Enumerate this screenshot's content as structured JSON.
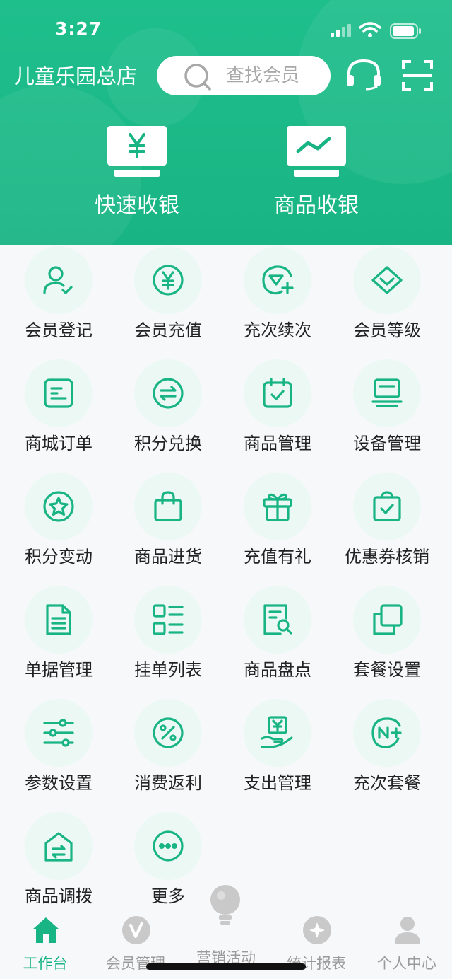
{
  "status_bar": {
    "time": "3:27"
  },
  "header": {
    "store_name": "儿童乐园总店",
    "search_placeholder": "查找会员",
    "quick_actions": [
      {
        "label": "快速收银",
        "icon": "yen-monitor-icon"
      },
      {
        "label": "商品收银",
        "icon": "chart-monitor-icon"
      }
    ]
  },
  "grid_items": [
    {
      "label": "会员登记",
      "icon": "user-check-icon"
    },
    {
      "label": "会员充值",
      "icon": "yen-circle-icon"
    },
    {
      "label": "充次续次",
      "icon": "diamond-plus-icon"
    },
    {
      "label": "会员等级",
      "icon": "diamond-icon"
    },
    {
      "label": "商城订单",
      "icon": "order-doc-icon"
    },
    {
      "label": "积分兑换",
      "icon": "exchange-icon"
    },
    {
      "label": "商品管理",
      "icon": "calendar-check-icon"
    },
    {
      "label": "设备管理",
      "icon": "device-icon"
    },
    {
      "label": "积分变动",
      "icon": "star-circle-icon"
    },
    {
      "label": "商品进货",
      "icon": "shopping-bag-icon"
    },
    {
      "label": "充值有礼",
      "icon": "gift-icon"
    },
    {
      "label": "优惠券核销",
      "icon": "coupon-check-icon"
    },
    {
      "label": "单据管理",
      "icon": "document-icon"
    },
    {
      "label": "挂单列表",
      "icon": "list-icon"
    },
    {
      "label": "商品盘点",
      "icon": "inventory-search-icon"
    },
    {
      "label": "套餐设置",
      "icon": "copy-icon"
    },
    {
      "label": "参数设置",
      "icon": "sliders-icon"
    },
    {
      "label": "消费返利",
      "icon": "percent-icon"
    },
    {
      "label": "支出管理",
      "icon": "hand-yen-icon"
    },
    {
      "label": "充次套餐",
      "icon": "n-plus-icon"
    },
    {
      "label": "商品调拨",
      "icon": "transfer-icon"
    },
    {
      "label": "更多",
      "icon": "more-icon"
    }
  ],
  "tabbar": {
    "tabs": [
      {
        "label": "工作台",
        "icon": "home-icon",
        "active": true
      },
      {
        "label": "会员管理",
        "icon": "member-icon",
        "active": false
      },
      {
        "label": "营销活动",
        "icon": "bulb-icon",
        "active": false
      },
      {
        "label": "统计报表",
        "icon": "report-icon",
        "active": false
      },
      {
        "label": "个人中心",
        "icon": "person-icon",
        "active": false
      }
    ]
  },
  "colors": {
    "brand": "#19b483",
    "icon_bg": "#ecf8f4",
    "tab_inactive": "#9a9a9a"
  }
}
